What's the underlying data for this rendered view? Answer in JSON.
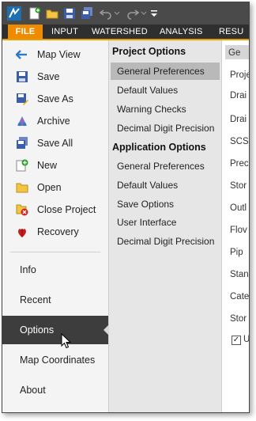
{
  "ribbon": {
    "tabs": [
      {
        "label": "FILE"
      },
      {
        "label": "INPUT"
      },
      {
        "label": "WATERSHED"
      },
      {
        "label": "ANALYSIS"
      },
      {
        "label": "RESU"
      }
    ]
  },
  "file_menu": {
    "items": [
      {
        "label": "Map View",
        "icon": "map-view-icon"
      },
      {
        "label": "Save",
        "icon": "floppy-disk-icon"
      },
      {
        "label": "Save As",
        "icon": "save-as-icon"
      },
      {
        "label": "Archive",
        "icon": "archive-icon"
      },
      {
        "label": "Save All",
        "icon": "save-all-icon"
      },
      {
        "label": "New",
        "icon": "new-file-icon"
      },
      {
        "label": "Open",
        "icon": "folder-icon"
      },
      {
        "label": "Close Project",
        "icon": "close-project-icon"
      },
      {
        "label": "Recovery",
        "icon": "recovery-icon"
      }
    ],
    "sections": [
      {
        "label": "Info"
      },
      {
        "label": "Recent"
      },
      {
        "label": "Options",
        "selected": true
      },
      {
        "label": "Map Coordinates"
      },
      {
        "label": "About"
      }
    ]
  },
  "options_panel": {
    "project_header": "Project Options",
    "project_items": [
      {
        "label": "General Preferences",
        "selected": true
      },
      {
        "label": "Default Values"
      },
      {
        "label": "Warning Checks"
      },
      {
        "label": "Decimal Digit Precision"
      }
    ],
    "application_header": "Application Options",
    "application_items": [
      {
        "label": "General Preferences"
      },
      {
        "label": "Default Values"
      },
      {
        "label": "Save Options"
      },
      {
        "label": "User Interface"
      },
      {
        "label": "Decimal Digit Precision"
      }
    ]
  },
  "right_panel": {
    "items": [
      "Ge",
      "Proje",
      "Drai",
      "Drai",
      "SCS",
      "Prec",
      "Stor",
      "Outl",
      "Flov",
      "Pip",
      "Stan",
      "Cate",
      "Stor",
      "Us"
    ],
    "checkbox_checked": true
  },
  "colors": {
    "file_tab": "#ee8b00",
    "title_bar": "#4a4a4a",
    "selected_section": "#3d3d3d",
    "selected_option": "#b9b9b9"
  }
}
